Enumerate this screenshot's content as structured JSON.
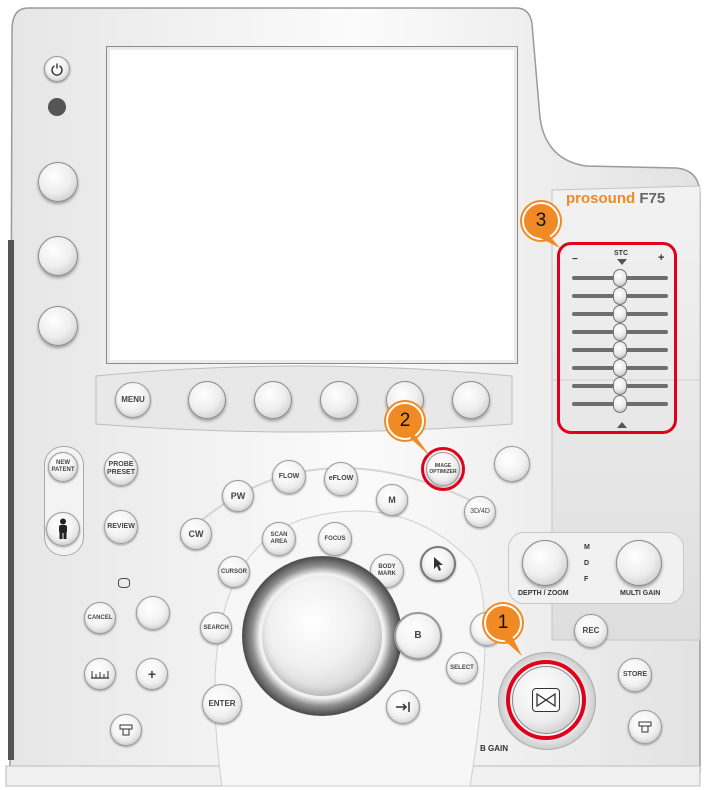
{
  "brand": {
    "prefix": "prosound",
    "model": "F75",
    "accent": "#f08a24"
  },
  "callouts": [
    "1",
    "2",
    "3"
  ],
  "highlight_color": "#e0001b",
  "labels": {
    "stc": "STC",
    "stc_minus": "−",
    "stc_plus": "+",
    "depth_zoom": "DEPTH / ZOOM",
    "multi_gain": "MULTI GAIN",
    "b_gain": "B GAIN",
    "m_indicator": "M",
    "d_indicator": "D",
    "f_indicator": "F"
  },
  "stc_sliders": [
    0.5,
    0.5,
    0.5,
    0.5,
    0.5,
    0.5,
    0.5,
    0.5
  ],
  "buttons": {
    "menu": "MENU",
    "new_patient": "NEW PATENT",
    "probe_preset": "PROBE PRESET",
    "review": "REVIEW",
    "pw": "PW",
    "flow": "FLOW",
    "eflow": "eFLOW",
    "m": "M",
    "cw": "CW",
    "scan_area": "SCAN AREA",
    "focus": "FOCUS",
    "cursor": "CURSOR",
    "body_mark": "BODY MARK",
    "search": "SEARCH",
    "cancel": "CANCEL",
    "enter": "ENTER",
    "select": "SELECT",
    "b": "B",
    "rec": "REC",
    "store": "STORE",
    "image_optimizer": "IMAGE OPTIMIZER",
    "three_d_four_d": "3D/4D",
    "plus": "+"
  }
}
